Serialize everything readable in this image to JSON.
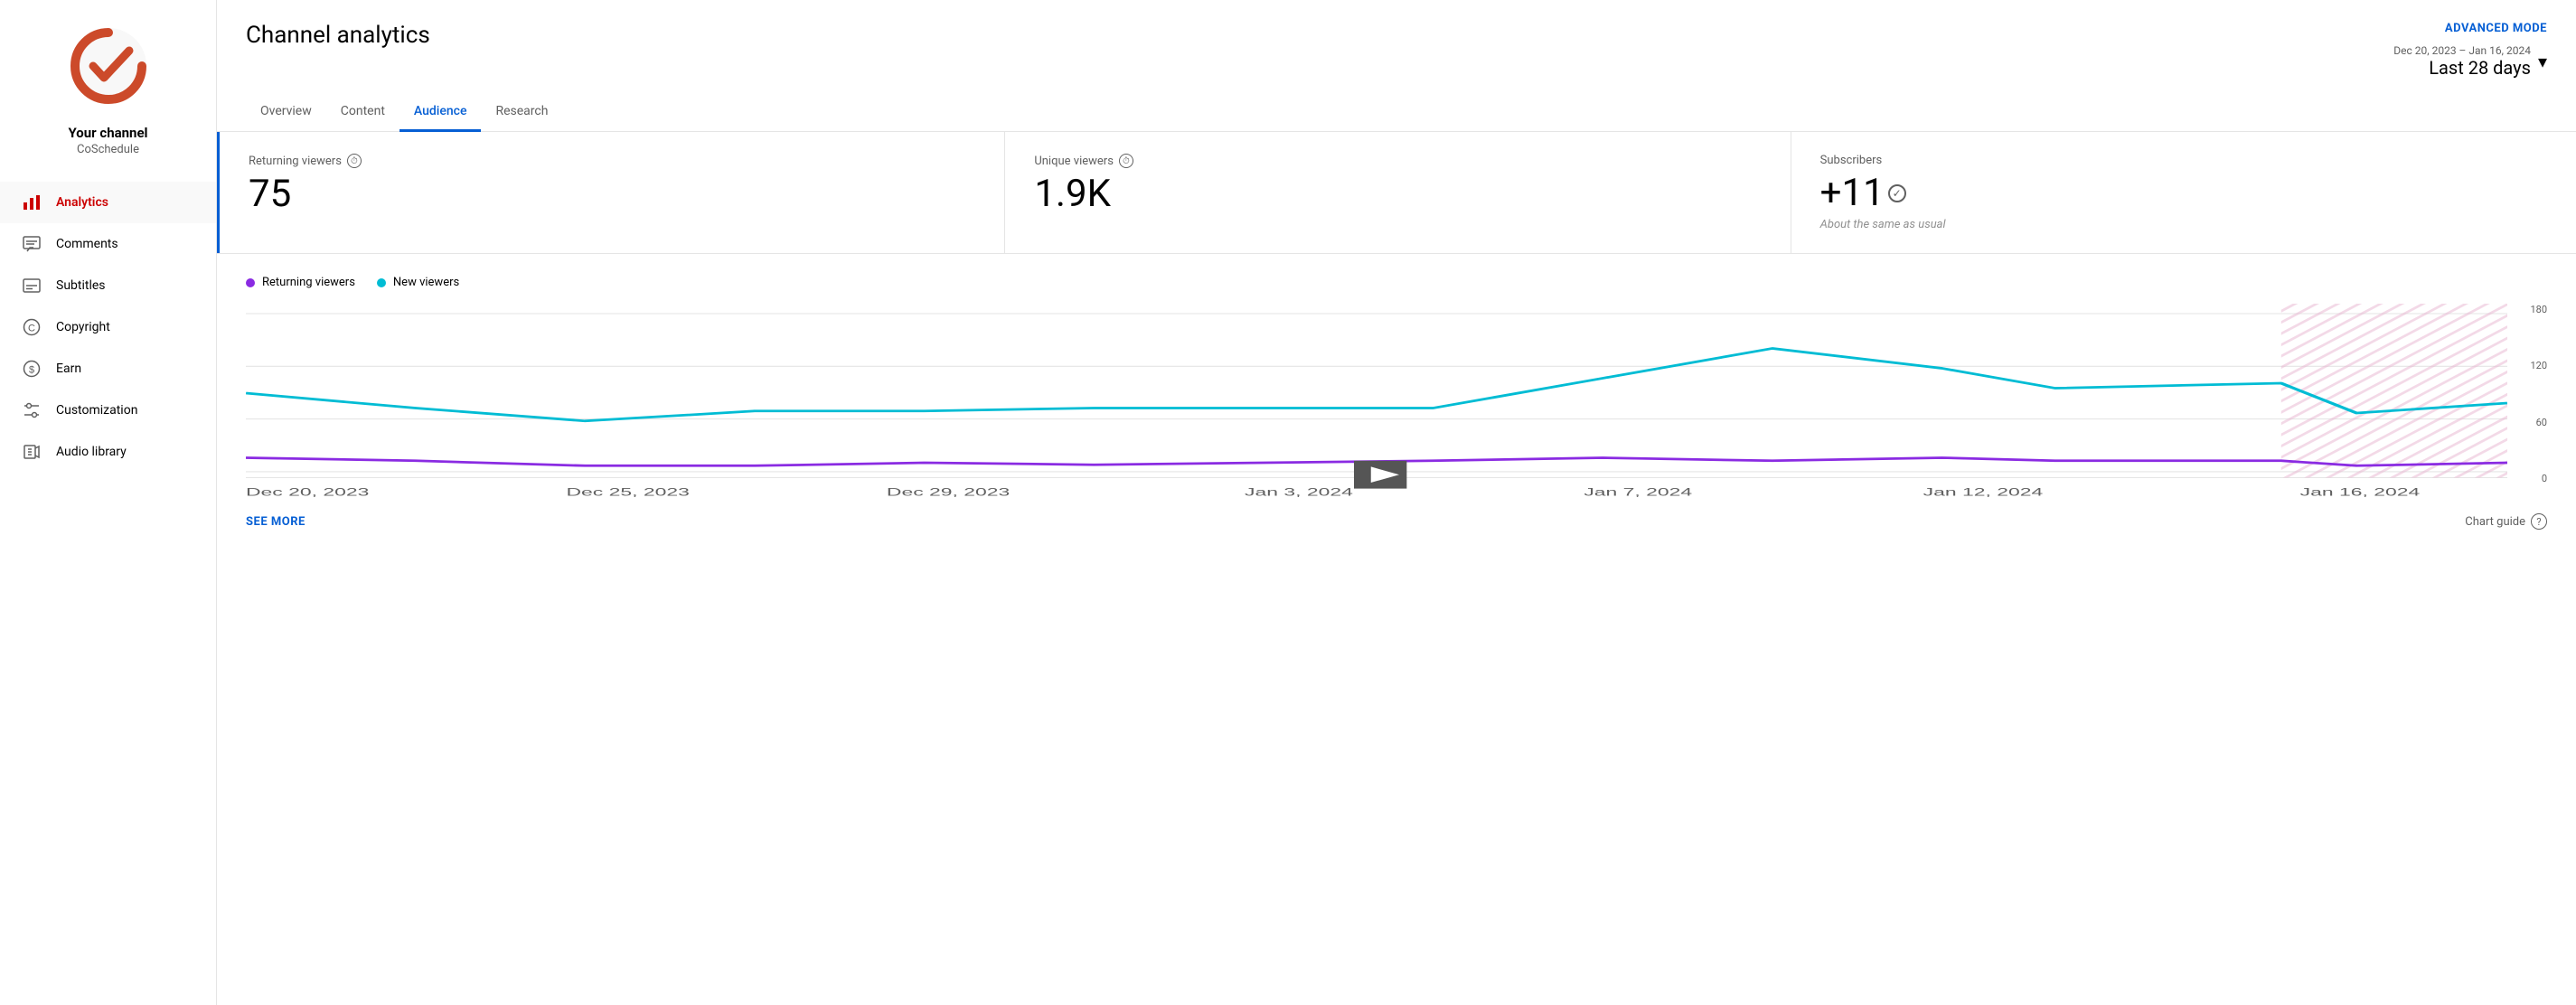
{
  "sidebar": {
    "logo_alt": "CoSchedule Logo",
    "channel_name": "Your channel",
    "channel_handle": "CoSchedule",
    "nav_items": [
      {
        "id": "analytics",
        "label": "Analytics",
        "icon": "chart-icon",
        "active": true
      },
      {
        "id": "comments",
        "label": "Comments",
        "icon": "comments-icon",
        "active": false
      },
      {
        "id": "subtitles",
        "label": "Subtitles",
        "icon": "subtitles-icon",
        "active": false
      },
      {
        "id": "copyright",
        "label": "Copyright",
        "icon": "copyright-icon",
        "active": false
      },
      {
        "id": "earn",
        "label": "Earn",
        "icon": "earn-icon",
        "active": false
      },
      {
        "id": "customization",
        "label": "Customization",
        "icon": "customization-icon",
        "active": false
      },
      {
        "id": "audio-library",
        "label": "Audio library",
        "icon": "audio-icon",
        "active": false
      }
    ]
  },
  "header": {
    "title": "Channel analytics",
    "advanced_mode": "ADVANCED MODE",
    "date_subtitle": "Dec 20, 2023 – Jan 16, 2024",
    "date_main": "Last 28 days",
    "tabs": [
      {
        "id": "overview",
        "label": "Overview",
        "active": false
      },
      {
        "id": "content",
        "label": "Content",
        "active": false
      },
      {
        "id": "audience",
        "label": "Audience",
        "active": true
      },
      {
        "id": "research",
        "label": "Research",
        "active": false
      }
    ]
  },
  "stats": [
    {
      "id": "returning-viewers",
      "label": "Returning viewers",
      "value": "75",
      "sub": null,
      "has_check": false
    },
    {
      "id": "unique-viewers",
      "label": "Unique viewers",
      "value": "1.9K",
      "sub": null,
      "has_check": false
    },
    {
      "id": "subscribers",
      "label": "Subscribers",
      "value": "+11",
      "sub": "About the same as usual",
      "has_check": true
    }
  ],
  "chart": {
    "legend": [
      {
        "id": "returning",
        "label": "Returning viewers",
        "color": "#8a2be2"
      },
      {
        "id": "new",
        "label": "New viewers",
        "color": "#00bcd4"
      }
    ],
    "x_labels": [
      "Dec 20, 2023",
      "Dec 25, 2023",
      "Dec 29, 2023",
      "Jan 3, 2024",
      "Jan 7, 2024",
      "Jan 12, 2024",
      "Jan 16, 2024"
    ],
    "y_labels": [
      "180",
      "120",
      "60",
      "0"
    ],
    "see_more": "SEE MORE",
    "chart_guide": "Chart guide"
  }
}
